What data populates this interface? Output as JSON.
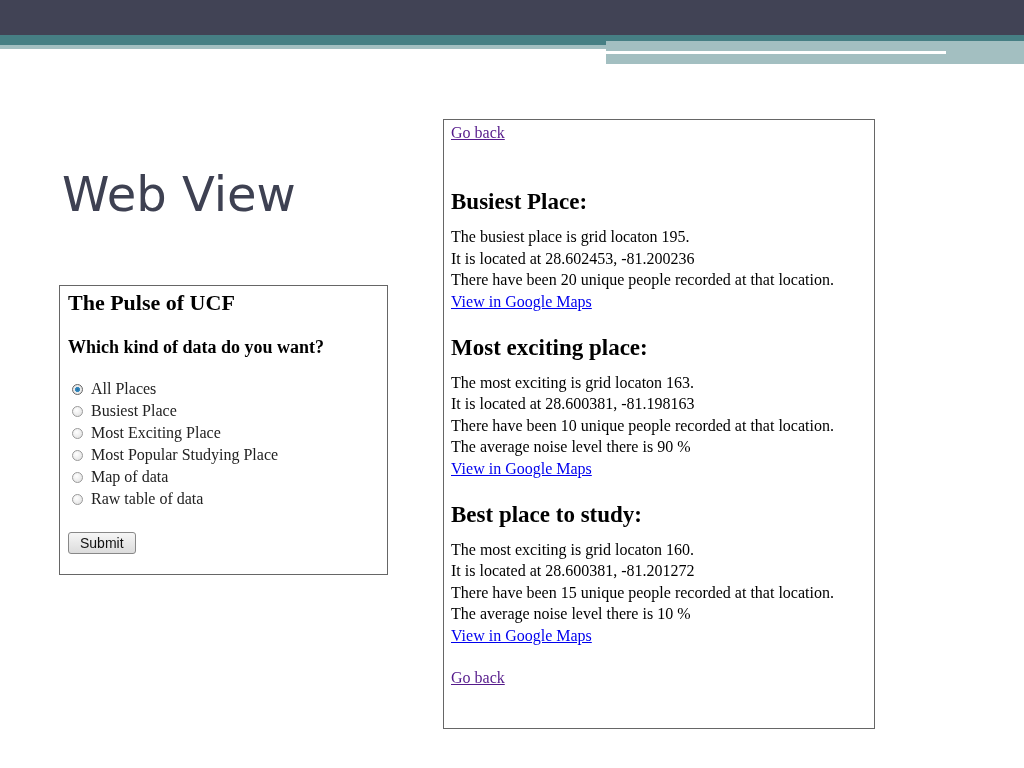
{
  "slide_title": "Web View",
  "form_page": {
    "heading": "The Pulse of UCF",
    "question": "Which kind of data do you want?",
    "options": [
      {
        "label": "All Places",
        "selected": true
      },
      {
        "label": "Busiest Place",
        "selected": false
      },
      {
        "label": "Most Exciting Place",
        "selected": false
      },
      {
        "label": "Most Popular Studying Place",
        "selected": false
      },
      {
        "label": "Map of data",
        "selected": false
      },
      {
        "label": "Raw table of data",
        "selected": false
      }
    ],
    "submit": "Submit"
  },
  "results_page": {
    "top_link": {
      "text": "Go back",
      "visited": true
    },
    "sections": [
      {
        "heading": "Busiest Place:",
        "lines": [
          "The busiest place is grid locaton 195.",
          "It is located at 28.602453, -81.200236",
          "There have been 20 unique people recorded at that location."
        ],
        "link": {
          "text": "View in Google Maps",
          "visited": false
        }
      },
      {
        "heading": "Most exciting place:",
        "lines": [
          "The most exciting is grid locaton 163.",
          "It is located at 28.600381, -81.198163",
          "There have been 10 unique people recorded at that location.",
          "The average noise level there is 90 %"
        ],
        "link": {
          "text": "View in Google Maps",
          "visited": false
        }
      },
      {
        "heading": "Best place to study:",
        "lines": [
          "The most exciting is grid locaton 160.",
          "It is located at 28.600381, -81.201272",
          "There have been 15 unique people recorded at that location.",
          "The average noise level there is 10 %"
        ],
        "link": {
          "text": "View in Google Maps",
          "visited": false
        }
      }
    ],
    "bottom_link": {
      "text": "Go back",
      "visited": true
    }
  }
}
